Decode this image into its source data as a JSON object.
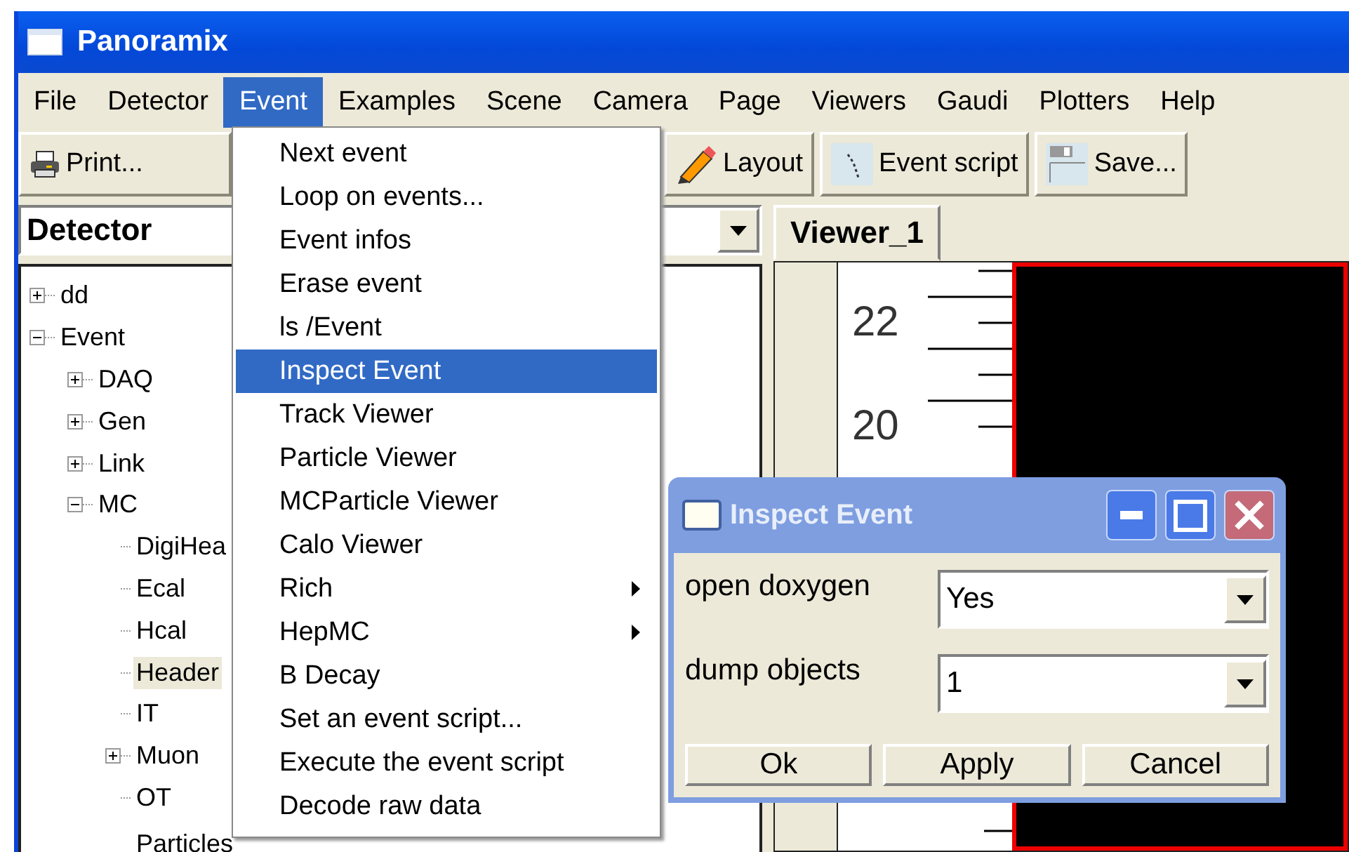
{
  "window": {
    "title": "Panoramix"
  },
  "menubar": [
    {
      "label": "File",
      "selected": false
    },
    {
      "label": "Detector",
      "selected": false
    },
    {
      "label": "Event",
      "selected": true
    },
    {
      "label": "Examples",
      "selected": false
    },
    {
      "label": "Scene",
      "selected": false
    },
    {
      "label": "Camera",
      "selected": false
    },
    {
      "label": "Page",
      "selected": false
    },
    {
      "label": "Viewers",
      "selected": false
    },
    {
      "label": "Gaudi",
      "selected": false
    },
    {
      "label": "Plotters",
      "selected": false
    },
    {
      "label": "Help",
      "selected": false
    }
  ],
  "toolbar": {
    "left": [
      {
        "label": "Print...",
        "kind": "printer"
      }
    ],
    "right": [
      {
        "label": "Layout",
        "kind": "pencil"
      },
      {
        "label": "Event script",
        "kind": "script"
      },
      {
        "label": "Save...",
        "kind": "save"
      }
    ]
  },
  "combo": {
    "value": "Detector"
  },
  "tree": [
    {
      "label": "dd",
      "expanded": false,
      "selected": false
    },
    {
      "label": "Event",
      "expanded": true,
      "selected": false,
      "children": [
        {
          "label": "DAQ",
          "expanded": false,
          "selected": false
        },
        {
          "label": "Gen",
          "expanded": false,
          "selected": false
        },
        {
          "label": "Link",
          "expanded": false,
          "selected": false
        },
        {
          "label": "MC",
          "expanded": true,
          "selected": false,
          "children": [
            {
              "label": "DigiHea",
              "selected": false
            },
            {
              "label": "Ecal",
              "selected": false
            },
            {
              "label": "Hcal",
              "selected": false
            },
            {
              "label": "Header",
              "selected": true
            },
            {
              "label": "IT",
              "selected": false
            },
            {
              "label": "Muon",
              "expanded": false,
              "selected": false
            },
            {
              "label": "OT",
              "selected": false
            },
            {
              "label": "Particles",
              "selected": false
            }
          ]
        }
      ]
    }
  ],
  "viewer": {
    "tabs": [
      {
        "label": "Viewer_1",
        "selected": true
      }
    ],
    "axis_labels": [
      "22",
      "20"
    ]
  },
  "event_menu": [
    {
      "label": "Next event",
      "selected": false,
      "submenu": false
    },
    {
      "label": "Loop on events...",
      "selected": false,
      "submenu": false
    },
    {
      "label": "Event infos",
      "selected": false,
      "submenu": false
    },
    {
      "label": "Erase event",
      "selected": false,
      "submenu": false
    },
    {
      "label": "ls /Event",
      "selected": false,
      "submenu": false
    },
    {
      "label": "Inspect Event",
      "selected": true,
      "submenu": false
    },
    {
      "label": "Track Viewer",
      "selected": false,
      "submenu": false
    },
    {
      "label": "Particle Viewer",
      "selected": false,
      "submenu": false
    },
    {
      "label": "MCParticle Viewer",
      "selected": false,
      "submenu": false
    },
    {
      "label": "Calo Viewer",
      "selected": false,
      "submenu": false
    },
    {
      "label": "Rich",
      "selected": false,
      "submenu": true
    },
    {
      "label": "HepMC",
      "selected": false,
      "submenu": true
    },
    {
      "label": "B Decay",
      "selected": false,
      "submenu": false
    },
    {
      "label": "Set an event script...",
      "selected": false,
      "submenu": false
    },
    {
      "label": "Execute the event script",
      "selected": false,
      "submenu": false
    },
    {
      "label": "Decode raw data",
      "selected": false,
      "submenu": false
    }
  ],
  "dialog": {
    "title": "Inspect Event",
    "fields": [
      {
        "label": "open doxygen",
        "value": "Yes"
      },
      {
        "label": "dump objects",
        "value": "1"
      }
    ],
    "buttons": [
      "Ok",
      "Apply",
      "Cancel"
    ]
  }
}
